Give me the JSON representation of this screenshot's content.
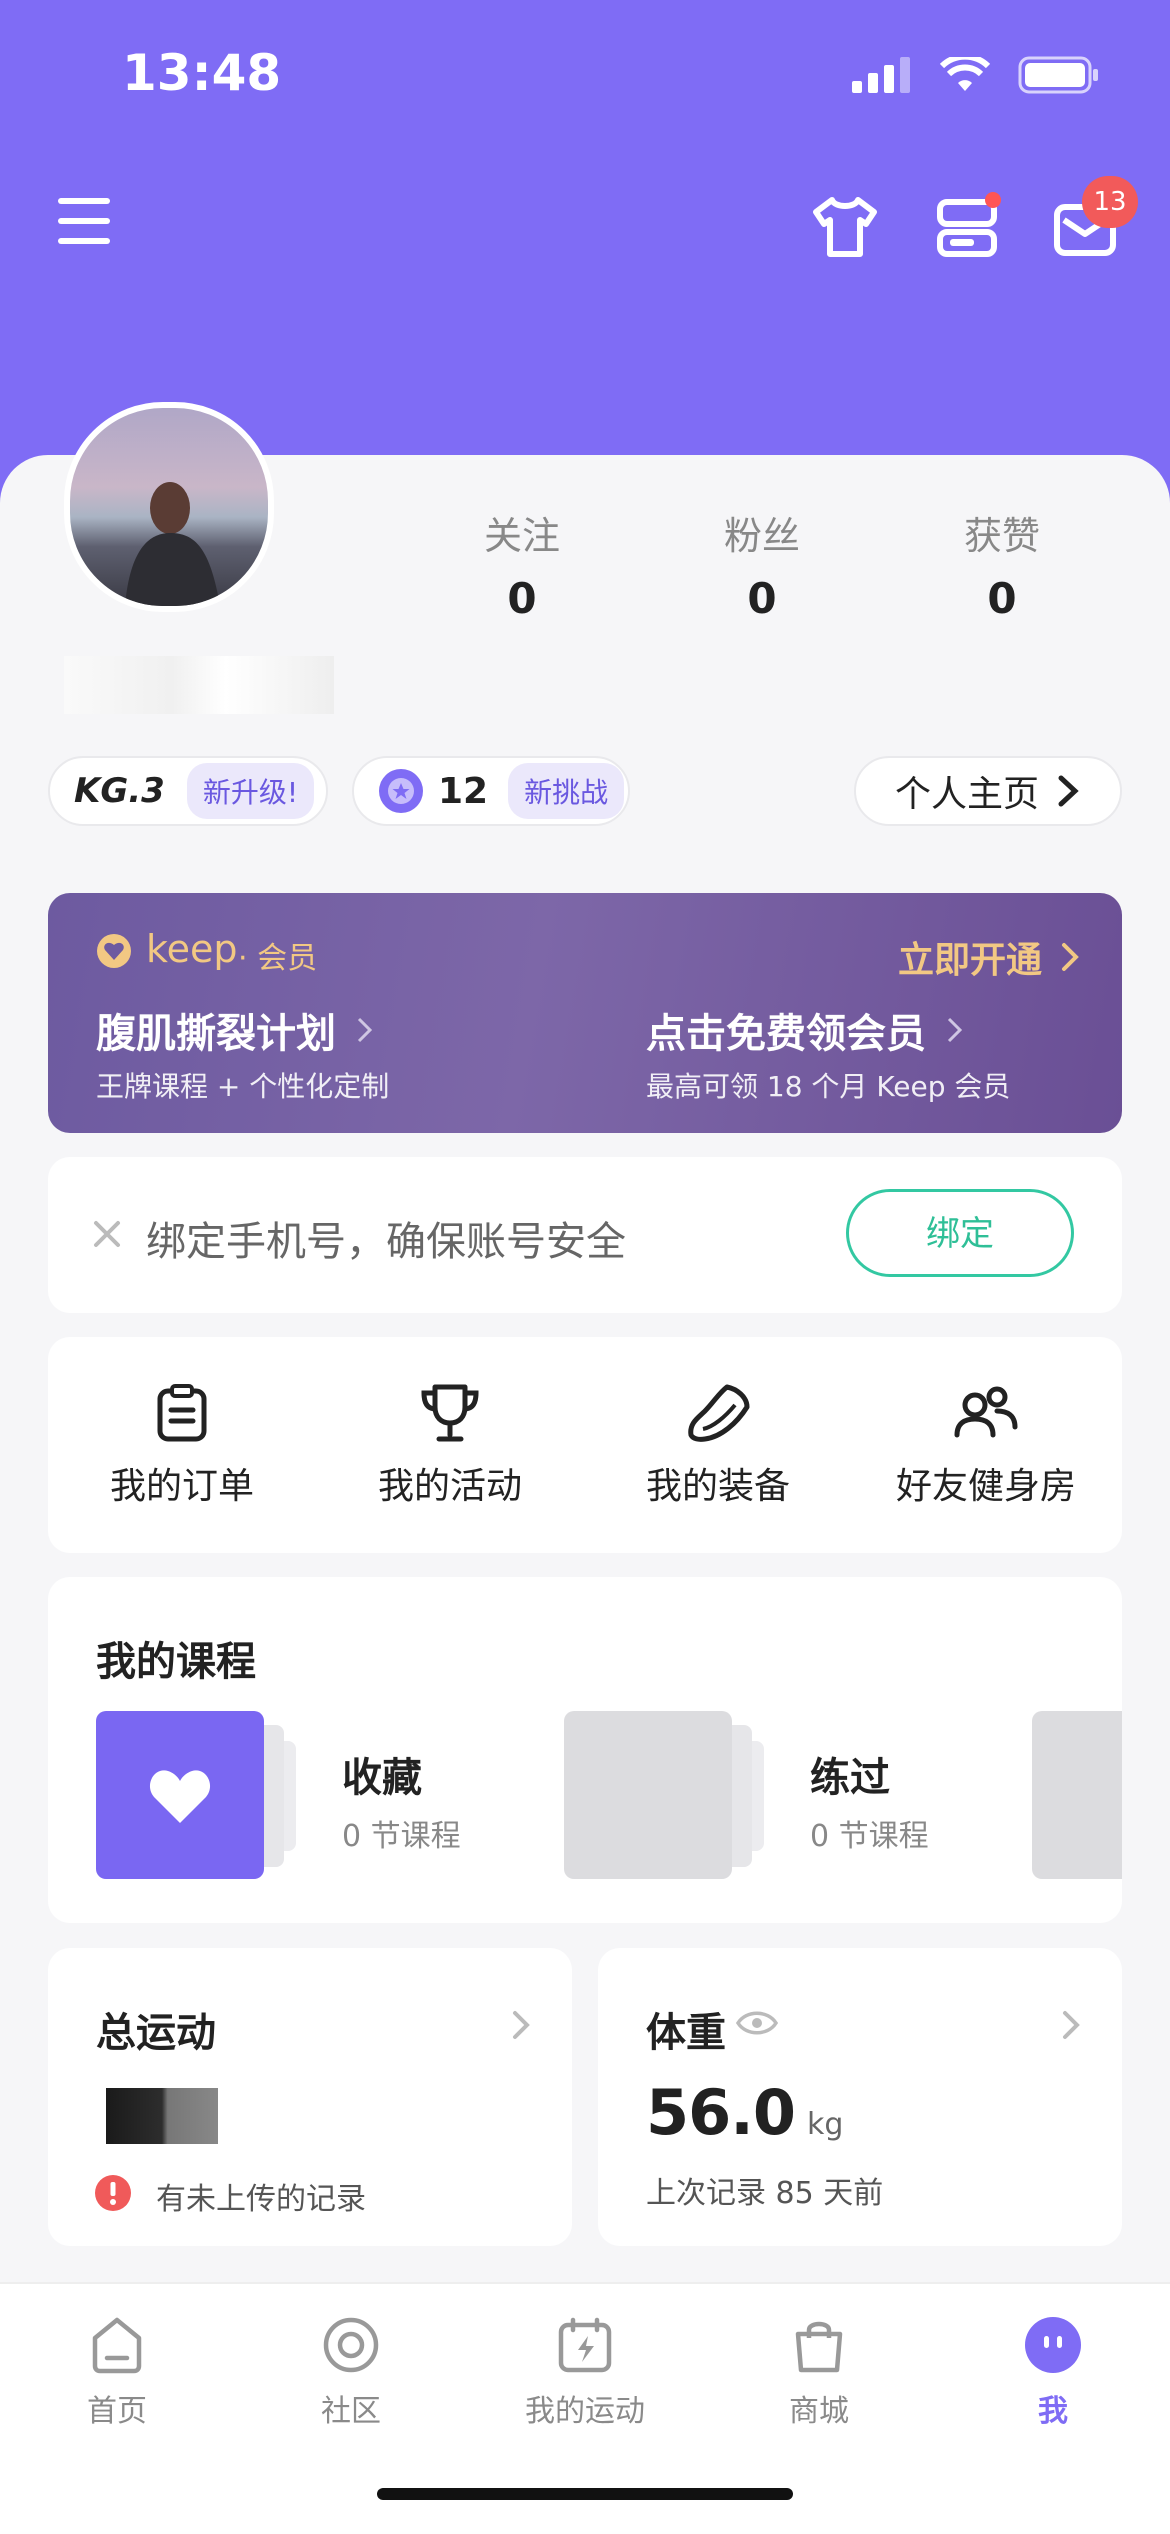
{
  "status_bar": {
    "time": "13:48"
  },
  "header": {
    "notification_count": "13"
  },
  "profile": {
    "stats": [
      {
        "label": "关注",
        "value": "0"
      },
      {
        "label": "粉丝",
        "value": "0"
      },
      {
        "label": "获赞",
        "value": "0"
      }
    ],
    "kg_level": "KG.3",
    "kg_tag": "新升级!",
    "challenge_count": "12",
    "challenge_tag": "新挑战",
    "homepage_label": "个人主页"
  },
  "vip": {
    "brand": "keep",
    "brand_suffix": "· 会员",
    "cta": "立即开通",
    "left_title": "腹肌撕裂计划",
    "left_sub": "王牌课程 + 个性化定制",
    "right_title": "点击免费领会员",
    "right_sub": "最高可领 18 个月 Keep 会员"
  },
  "bind": {
    "text": "绑定手机号，确保账号安全",
    "button": "绑定"
  },
  "quick_actions": [
    {
      "label": "我的订单",
      "icon": "clipboard-icon"
    },
    {
      "label": "我的活动",
      "icon": "trophy-icon"
    },
    {
      "label": "我的装备",
      "icon": "shoe-icon"
    },
    {
      "label": "好友健身房",
      "icon": "friends-icon"
    }
  ],
  "courses": {
    "title": "我的课程",
    "items": [
      {
        "name": "收藏",
        "count": "0 节课程"
      },
      {
        "name": "练过",
        "count": "0 节课程"
      }
    ]
  },
  "total_exercise": {
    "title": "总运动",
    "warning": "有未上传的记录"
  },
  "weight": {
    "title": "体重",
    "value": "56.0",
    "unit": "kg",
    "last_record": "上次记录 85 天前"
  },
  "tabbar": [
    {
      "label": "首页",
      "icon": "home-icon"
    },
    {
      "label": "社区",
      "icon": "community-icon"
    },
    {
      "label": "我的运动",
      "icon": "calendar-bolt-icon"
    },
    {
      "label": "商城",
      "icon": "shopping-bag-icon"
    },
    {
      "label": "我",
      "icon": "me-icon"
    }
  ],
  "colors": {
    "accent": "#7f6cf5",
    "bind_green": "#2fbf97",
    "vip_gold": "#f2c883"
  }
}
